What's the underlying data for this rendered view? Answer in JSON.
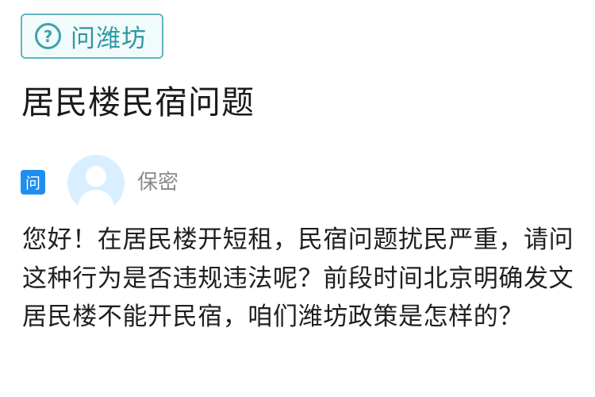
{
  "tag": {
    "icon": "question-circle-icon",
    "icon_glyph": "?",
    "label": "问潍坊",
    "colors": {
      "border": "#5fb7bf",
      "text": "#2d98a4"
    }
  },
  "question": {
    "title": "居民楼民宿问题",
    "badge": "问",
    "badge_color": "#1f8ef0",
    "author": "保密",
    "body": "您好！在居民楼开短租，民宿问题扰民严重，请问这种行为是否违规违法呢？前段时间北京明确发文居民楼不能开民宿，咱们潍坊政策是怎样的？"
  }
}
